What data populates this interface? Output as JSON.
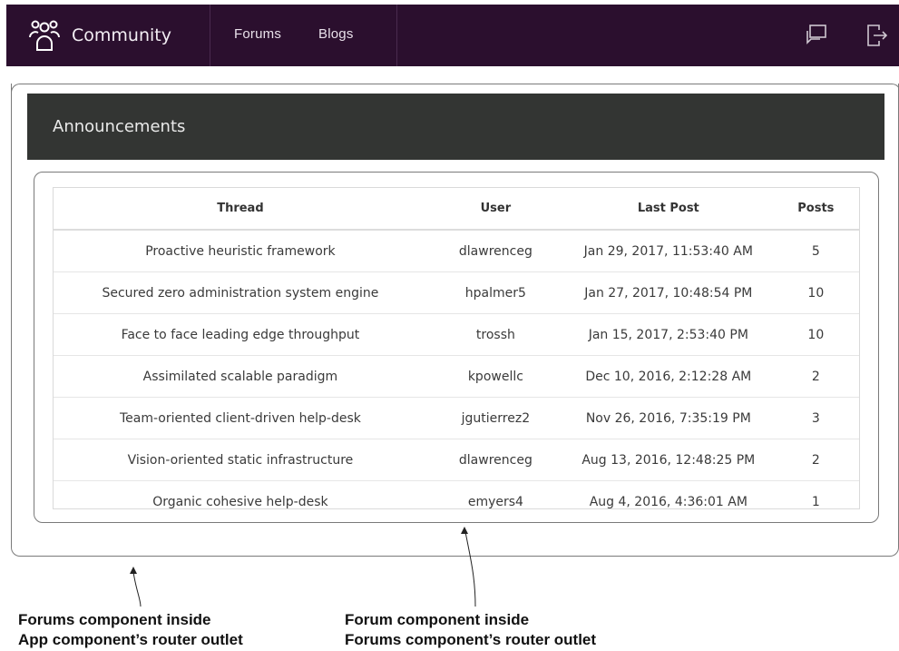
{
  "navbar": {
    "brand": "Community",
    "links": [
      "Forums",
      "Blogs"
    ],
    "icons": [
      "chat-icon",
      "logout-icon"
    ],
    "background": "#2b0f2e"
  },
  "announcements": {
    "title": "Announcements"
  },
  "table": {
    "columns": [
      "Thread",
      "User",
      "Last Post",
      "Posts"
    ],
    "rows": [
      [
        "Proactive heuristic framework",
        "dlawrenceg",
        "Jan 29, 2017, 11:53:40 AM",
        "5"
      ],
      [
        "Secured zero administration system engine",
        "hpalmer5",
        "Jan 27, 2017, 10:48:54 PM",
        "10"
      ],
      [
        "Face to face leading edge throughput",
        "trossh",
        "Jan 15, 2017, 2:53:40 PM",
        "10"
      ],
      [
        "Assimilated scalable paradigm",
        "kpowellc",
        "Dec 10, 2016, 2:12:28 AM",
        "2"
      ],
      [
        "Team-oriented client-driven help-desk",
        "jgutierrez2",
        "Nov 26, 2016, 7:35:19 PM",
        "3"
      ],
      [
        "Vision-oriented static infrastructure",
        "dlawrenceg",
        "Aug 13, 2016, 12:48:25 PM",
        "2"
      ],
      [
        "Organic cohesive help-desk",
        "emyers4",
        "Aug 4, 2016, 4:36:01 AM",
        "1"
      ]
    ]
  },
  "annotations": {
    "left": [
      "Forums component inside",
      "App component’s router outlet"
    ],
    "right": [
      "Forum component inside",
      "Forums component’s router outlet"
    ]
  }
}
